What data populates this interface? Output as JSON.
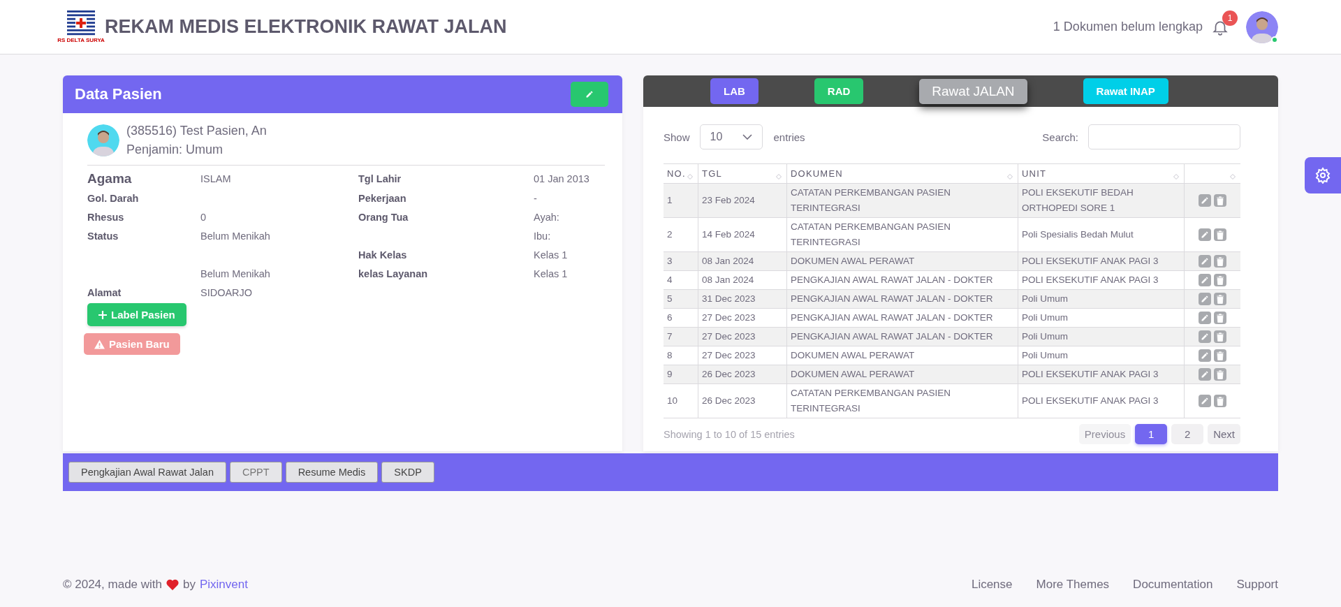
{
  "header": {
    "logo_caption": "RS DELTA SURYA",
    "title": "REKAM MEDIS ELEKTRONIK RAWAT JALAN",
    "notice": "1 Dokumen belum lengkap",
    "badge": "1",
    "user_online": true
  },
  "patient_card": {
    "title": "Data Pasien",
    "name": "(385516) Test Pasien, An",
    "guarantor": "Penjamin: Umum",
    "rows": [
      {
        "emphasized": true,
        "label": "Agama",
        "value": "ISLAM",
        "label_2": "Tgl Lahir",
        "value_2": "01 Jan 2013"
      },
      {
        "emphasized": false,
        "label": "Gol. Darah",
        "label_2": "Pekerjaan",
        "value_2": "-"
      },
      {
        "emphasized": false,
        "label": "Rhesus",
        "value": "0",
        "label_2": "Orang Tua",
        "value_2": "Ayah:"
      },
      {
        "emphasized": false,
        "label": "Status",
        "value": "Belum Menikah",
        "value_2": "Ibu:"
      },
      {
        "emphasized": false,
        "label_2": "Hak Kelas",
        "value_2": "Kelas 1"
      },
      {
        "emphasized": false,
        "value": "Belum Menikah",
        "label_2": "kelas Layanan",
        "value_2": "Kelas 1"
      },
      {
        "emphasized": false,
        "label": "Alamat",
        "value": "SIDOARJO"
      }
    ],
    "label_button": "Label Pasien",
    "new_patient_button": "Pasien Baru"
  },
  "documents_card": {
    "tabs": [
      {
        "label": "LAB",
        "color": "#7367f0",
        "selected": false
      },
      {
        "label": "RAD",
        "color": "#28c76f",
        "selected": false
      },
      {
        "label": "Rawat JALAN",
        "color": "#a8aaae",
        "selected": true
      },
      {
        "label": "Rawat INAP",
        "color": "#00cfe8",
        "selected": false
      }
    ],
    "show_label": "Show",
    "page_size": "10",
    "entries_label": "entries",
    "search_label": "Search:",
    "table": {
      "columns": [
        "NO.",
        "TGL",
        "DOKUMEN",
        "UNIT"
      ],
      "rows": [
        {
          "no": "1",
          "tgl": "23 Feb 2024",
          "dokumen": "CATATAN PERKEMBANGAN PASIEN TERINTEGRASI",
          "unit": "POLI EKSEKUTIF BEDAH ORTHOPEDI SORE 1"
        },
        {
          "no": "2",
          "tgl": "14 Feb 2024",
          "dokumen": "CATATAN PERKEMBANGAN PASIEN TERINTEGRASI",
          "unit": "Poli Spesialis Bedah Mulut"
        },
        {
          "no": "3",
          "tgl": "08 Jan 2024",
          "dokumen": "DOKUMEN AWAL PERAWAT",
          "unit": "POLI EKSEKUTIF ANAK PAGI 3"
        },
        {
          "no": "4",
          "tgl": "08 Jan 2024",
          "dokumen": "PENGKAJIAN AWAL RAWAT JALAN - DOKTER",
          "unit": "POLI EKSEKUTIF ANAK PAGI 3"
        },
        {
          "no": "5",
          "tgl": "31 Dec 2023",
          "dokumen": "PENGKAJIAN AWAL RAWAT JALAN - DOKTER",
          "unit": "Poli Umum"
        },
        {
          "no": "6",
          "tgl": "27 Dec 2023",
          "dokumen": "PENGKAJIAN AWAL RAWAT JALAN - DOKTER",
          "unit": "Poli Umum"
        },
        {
          "no": "7",
          "tgl": "27 Dec 2023",
          "dokumen": "PENGKAJIAN AWAL RAWAT JALAN - DOKTER",
          "unit": "Poli Umum"
        },
        {
          "no": "8",
          "tgl": "27 Dec 2023",
          "dokumen": "DOKUMEN AWAL PERAWAT",
          "unit": "Poli Umum"
        },
        {
          "no": "9",
          "tgl": "26 Dec 2023",
          "dokumen": "DOKUMEN AWAL PERAWAT",
          "unit": "POLI EKSEKUTIF ANAK PAGI 3"
        },
        {
          "no": "10",
          "tgl": "26 Dec 2023",
          "dokumen": "CATATAN PERKEMBANGAN PASIEN TERINTEGRASI",
          "unit": "POLI EKSEKUTIF ANAK PAGI 3"
        }
      ]
    },
    "info": "Showing 1 to 10 of 15 entries",
    "pagination": [
      {
        "label": "Previous",
        "kind": "nav",
        "disabled": true,
        "selected": false
      },
      {
        "label": "1",
        "kind": "page",
        "disabled": false,
        "selected": true
      },
      {
        "label": "2",
        "kind": "page",
        "disabled": false,
        "selected": false
      },
      {
        "label": "Next",
        "kind": "nav",
        "disabled": false,
        "selected": false
      }
    ]
  },
  "form_buttons": [
    {
      "label": "Pengkajian Awal Rawat Jalan",
      "disabled": false
    },
    {
      "label": "CPPT",
      "disabled": true
    },
    {
      "label": "Resume Medis",
      "disabled": false
    },
    {
      "label": "SKDP",
      "disabled": false
    }
  ],
  "footer": {
    "copyright": "© 2024, made with",
    "by": "by",
    "author": "Pixinvent",
    "links": [
      "License",
      "More Themes",
      "Documentation",
      "Support"
    ]
  }
}
